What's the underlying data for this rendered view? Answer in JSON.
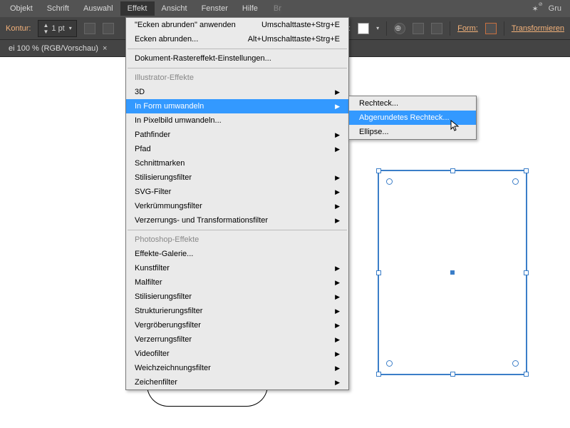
{
  "menubar": {
    "items": [
      "Objekt",
      "Schrift",
      "Auswahl",
      "Effekt",
      "Ansicht",
      "Fenster",
      "Hilfe"
    ],
    "active_index": 3,
    "right_label": "Gru"
  },
  "toolbar": {
    "kontur_label": "Kontur:",
    "pt_value": "1 pt",
    "stil_label": "Stil:",
    "form_label": "Form:",
    "transform_label": "Transformieren"
  },
  "tab": {
    "title": "ei 100 % (RGB/Vorschau)",
    "close": "×"
  },
  "menu": {
    "apply_effect": "\"Ecken abrunden\" anwenden",
    "apply_shortcut": "Umschalttaste+Strg+E",
    "round_corners": "Ecken abrunden...",
    "round_shortcut": "Alt+Umschalttaste+Strg+E",
    "doc_raster": "Dokument-Rastereffekt-Einstellungen...",
    "illustrator_header": "Illustrator-Effekte",
    "items_illustrator": [
      "3D",
      "In Form umwandeln",
      "In Pixelbild umwandeln...",
      "Pathfinder",
      "Pfad",
      "Schnittmarken",
      "Stilisierungsfilter",
      "SVG-Filter",
      "Verkrümmungsfilter",
      "Verzerrungs- und Transformationsfilter"
    ],
    "photoshop_header": "Photoshop-Effekte",
    "items_photoshop": [
      "Effekte-Galerie...",
      "Kunstfilter",
      "Malfilter",
      "Stilisierungsfilter",
      "Strukturierungsfilter",
      "Vergröberungsfilter",
      "Verzerrungsfilter",
      "Videofilter",
      "Weichzeichnungsfilter",
      "Zeichenfilter"
    ],
    "highlighted_index": 1
  },
  "submenu": {
    "items": [
      "Rechteck...",
      "Abgerundetes Rechteck...",
      "Ellipse..."
    ],
    "highlighted_index": 1
  }
}
